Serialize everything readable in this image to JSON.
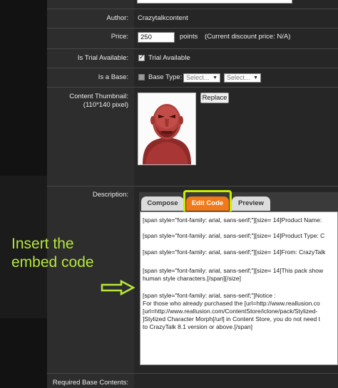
{
  "form": {
    "author": {
      "label": "Author:",
      "value": "Crazytalkcontent"
    },
    "price": {
      "label": "Price:",
      "value": "250",
      "unit": "points",
      "discount_note": "(Current discount price: N/A)"
    },
    "trial": {
      "label": "Is Trial Available:",
      "checked": true,
      "checkbox_label": "Trial Available"
    },
    "base": {
      "label": "Is a Base:",
      "checked": false,
      "base_type_label": "Base Type:",
      "select1_value": "Select...",
      "select2_value": "Select..."
    },
    "thumbnail": {
      "label": "Content Thumbnail:",
      "sublabel": "(110*140 pixel)",
      "replace_label": "Replace"
    },
    "description": {
      "label": "Description:",
      "tabs": [
        {
          "label": "Compose",
          "active": false
        },
        {
          "label": "Edit Code",
          "active": true
        },
        {
          "label": "Preview",
          "active": false
        }
      ],
      "code_lines": [
        "[span style=\"font-family: arial, sans-serif;\"][size= 14]Product Name:",
        "[span style=\"font-family: arial, sans-serif;\"][size= 14]Product Type: C",
        "[span style=\"font-family: arial, sans-serif;\"][size= 14]From: CrazyTalk",
        "[span style=\"font-family: arial, sans-serif;\"][size= 14]This pack show",
        "human style characters.[/span][/size]",
        "[span style=\"font-family: arial, sans-serif;\"]Notice :",
        "For those who already purchased the [url=http://www.reallusion.co",
        "[url=http://www.reallusion.com/ContentStore/iclone/pack/Stylized-",
        "]Stylized Character Morph[/url]  in Content Store, you do not need t",
        "to CrazyTalk 8.1 version or above.[/span]"
      ]
    },
    "required_base": {
      "label": "Required Base Contents:"
    }
  },
  "annotation": {
    "line1": "Insert the",
    "line2": "embed code",
    "arrow_color": "#b7e83a"
  },
  "colors": {
    "tab_active": "#f07a1a",
    "highlight": "#c6f000",
    "annotation": "#b7e83a"
  }
}
